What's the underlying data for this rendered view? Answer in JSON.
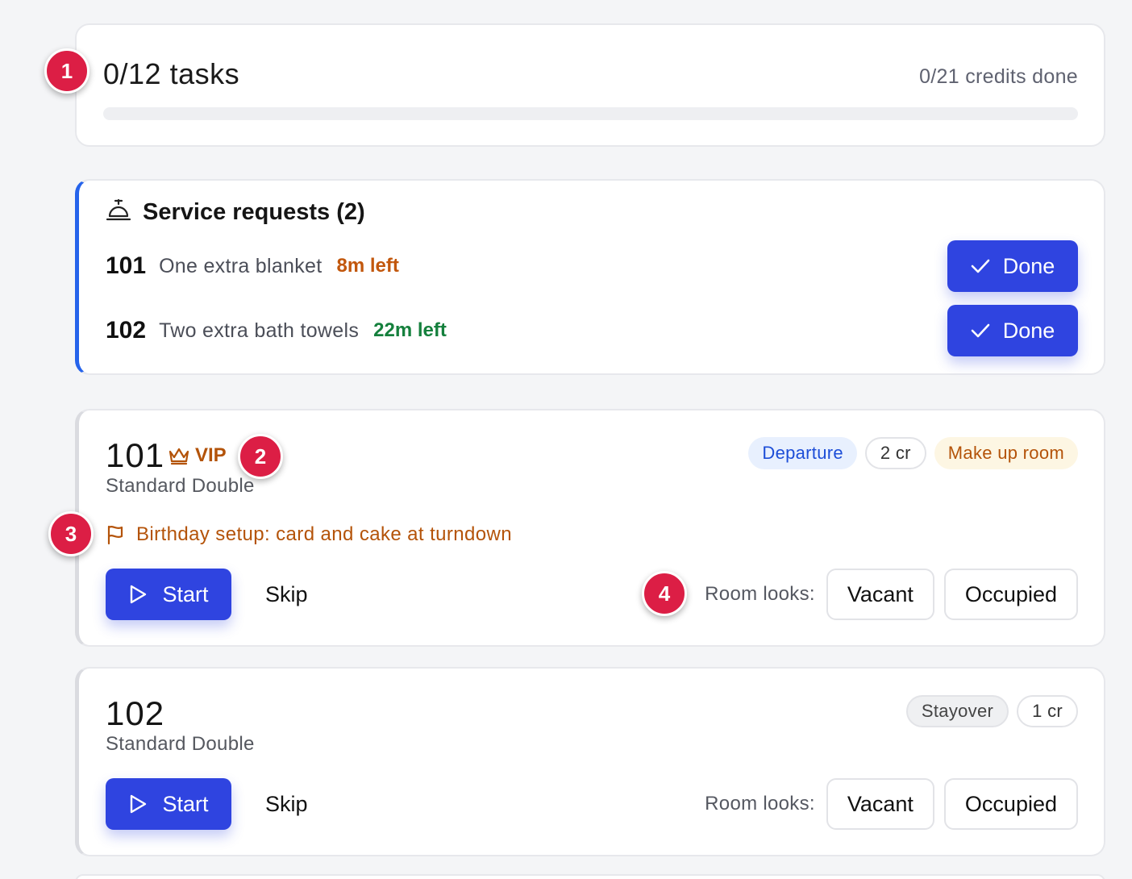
{
  "progress": {
    "tasks_text": "0/12 tasks",
    "credits_text": "0/21 credits done",
    "fraction": 0
  },
  "service_requests": {
    "title": "Service requests (2)",
    "icon": "bell-icon",
    "items": [
      {
        "room": "101",
        "text": "One extra blanket",
        "time": "8m left",
        "time_color": "#c2570c",
        "button": "Done"
      },
      {
        "room": "102",
        "text": "Two extra bath towels",
        "time": "22m left",
        "time_color": "#15803d",
        "button": "Done"
      }
    ]
  },
  "rooms": [
    {
      "number": "101",
      "type": "Standard Double",
      "vip_label": "VIP",
      "badges": [
        "Departure",
        "2 cr",
        "Make up room"
      ],
      "note": "Birthday setup: card and cake at turndown",
      "start_label": "Start",
      "skip_label": "Skip",
      "looks_label": "Room looks:",
      "vacant_label": "Vacant",
      "occupied_label": "Occupied"
    },
    {
      "number": "102",
      "type": "Standard Double",
      "badges": [
        "Stayover",
        "1 cr"
      ],
      "start_label": "Start",
      "skip_label": "Skip",
      "looks_label": "Room looks:",
      "vacant_label": "Vacant",
      "occupied_label": "Occupied"
    }
  ],
  "markers": [
    "1",
    "2",
    "3",
    "4"
  ],
  "colors": {
    "primary": "#2f44e0",
    "accent_border": "#2563eb",
    "marker": "#dc1e45",
    "vip": "#b35309",
    "departure_bg": "#e8f0fe",
    "departure_text": "#1d4ed8",
    "makeup_bg": "#fdf6e3",
    "makeup_text": "#b45309"
  }
}
